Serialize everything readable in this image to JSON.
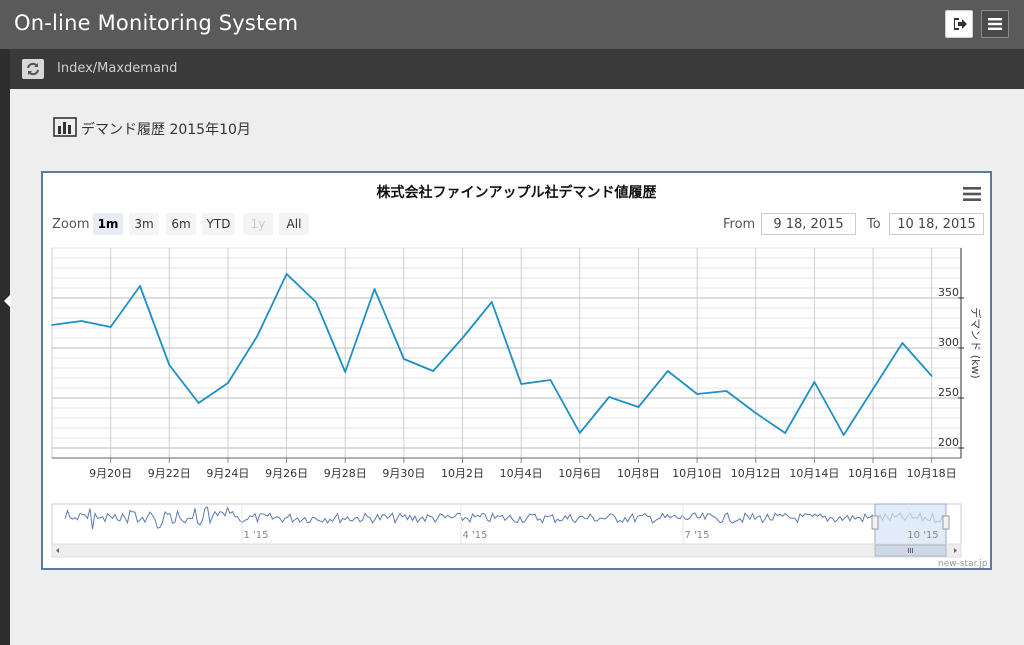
{
  "header": {
    "app_title": "On-line Monitoring System",
    "exit_icon": "sign-out-icon",
    "menu_icon": "hamburger-menu-icon"
  },
  "subbar": {
    "refresh_icon": "refresh-icon",
    "breadcrumb": "Index/Maxdemand"
  },
  "page": {
    "heading_icon": "bar-chart-icon",
    "heading": "デマンド履歴 2015年10月"
  },
  "chart_controls": {
    "zoom_label": "Zoom",
    "range_buttons": [
      {
        "label": "1m",
        "state": "active"
      },
      {
        "label": "3m",
        "state": "normal"
      },
      {
        "label": "6m",
        "state": "normal"
      },
      {
        "label": "YTD",
        "state": "normal"
      },
      {
        "label": "1y",
        "state": "disabled"
      },
      {
        "label": "All",
        "state": "normal"
      }
    ],
    "from_label": "From",
    "from_value": "9 18, 2015",
    "to_label": "To",
    "to_value": "10 18, 2015",
    "menu_icon": "chart-context-menu-icon"
  },
  "credit": "new-star.jp",
  "colors": {
    "line": "#1f8fc4",
    "panel_border": "#5b7aa0",
    "header_bg": "#5a5a5a",
    "navigator_fill": "#d6e4f7"
  },
  "chart_data": {
    "type": "line",
    "title": "株式会社ファインアップル社デマンド値履歴",
    "ylabel": "デマンド (kw)",
    "ylim": [
      190,
      400
    ],
    "yticks": [
      200,
      250,
      300,
      350
    ],
    "grid": true,
    "x_range": [
      "2015-09-18",
      "2015-10-19"
    ],
    "x_tick_labels": [
      "9月20日",
      "9月22日",
      "9月24日",
      "9月26日",
      "9月28日",
      "9月30日",
      "10月2日",
      "10月4日",
      "10月6日",
      "10月8日",
      "10月10日",
      "10月12日",
      "10月14日",
      "10月16日",
      "10月18日"
    ],
    "series": [
      {
        "values": [
          [
            "2015-09-18",
            323
          ],
          [
            "2015-09-19",
            327
          ],
          [
            "2015-09-20",
            321
          ],
          [
            "2015-09-21",
            362
          ],
          [
            "2015-09-22",
            283
          ],
          [
            "2015-09-23",
            245
          ],
          [
            "2015-09-24",
            265
          ],
          [
            "2015-09-25",
            312
          ],
          [
            "2015-09-26",
            374
          ],
          [
            "2015-09-27",
            346
          ],
          [
            "2015-09-28",
            276
          ],
          [
            "2015-09-29",
            359
          ],
          [
            "2015-09-30",
            289
          ],
          [
            "2015-10-01",
            277
          ],
          [
            "2015-10-02",
            310
          ],
          [
            "2015-10-03",
            346
          ],
          [
            "2015-10-04",
            264
          ],
          [
            "2015-10-05",
            268
          ],
          [
            "2015-10-06",
            215
          ],
          [
            "2015-10-07",
            251
          ],
          [
            "2015-10-08",
            241
          ],
          [
            "2015-10-09",
            277
          ],
          [
            "2015-10-10",
            254
          ],
          [
            "2015-10-11",
            257
          ],
          [
            "2015-10-12",
            235
          ],
          [
            "2015-10-13",
            215
          ],
          [
            "2015-10-14",
            266
          ],
          [
            "2015-10-15",
            213
          ],
          [
            "2015-10-16",
            259
          ],
          [
            "2015-10-17",
            305
          ],
          [
            "2015-10-18",
            272
          ]
        ]
      }
    ],
    "navigator": {
      "labels": [
        "1 '15",
        "4 '15",
        "7 '15",
        "10 '15"
      ],
      "selected_from": "2015-09-18",
      "selected_to": "2015-10-18"
    }
  }
}
